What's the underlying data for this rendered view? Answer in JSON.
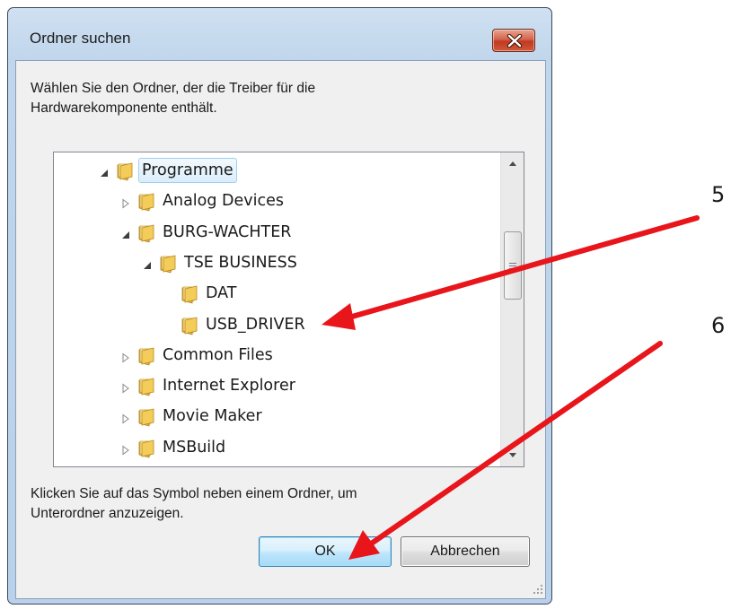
{
  "dialog": {
    "title": "Ordner suchen",
    "description_lines": [
      "Wählen Sie den Ordner, der die Treiber für die",
      "Hardwarekomponente enthält."
    ],
    "hint_lines": [
      "Klicken Sie auf das Symbol neben einem Ordner, um",
      "Unterordner anzuzeigen."
    ],
    "ok_label": "OK",
    "cancel_label": "Abbrechen"
  },
  "tree": {
    "items": [
      {
        "label": "Programme",
        "expander": "expanded",
        "selected": true
      },
      {
        "label": "Analog Devices",
        "expander": "collapsed"
      },
      {
        "label": "BURG-WACHTER",
        "expander": "expanded"
      },
      {
        "label": "TSE BUSINESS",
        "expander": "expanded"
      },
      {
        "label": "DAT",
        "expander": "none"
      },
      {
        "label": "USB_DRIVER",
        "expander": "none"
      },
      {
        "label": "Common Files",
        "expander": "collapsed"
      },
      {
        "label": "Internet Explorer",
        "expander": "collapsed"
      },
      {
        "label": "Movie Maker",
        "expander": "collapsed"
      },
      {
        "label": "MSBuild",
        "expander": "collapsed"
      }
    ]
  },
  "annotations": {
    "step_a": "5",
    "step_b": "6",
    "arrow_color": "#e8151b"
  },
  "icons": {
    "close": "close-icon",
    "folder": "folder-icon",
    "expanded": "triangle-expanded-icon",
    "collapsed": "triangle-collapsed-icon",
    "scroll_up": "scroll-up-arrow-icon",
    "scroll_down": "scroll-down-arrow-icon"
  }
}
